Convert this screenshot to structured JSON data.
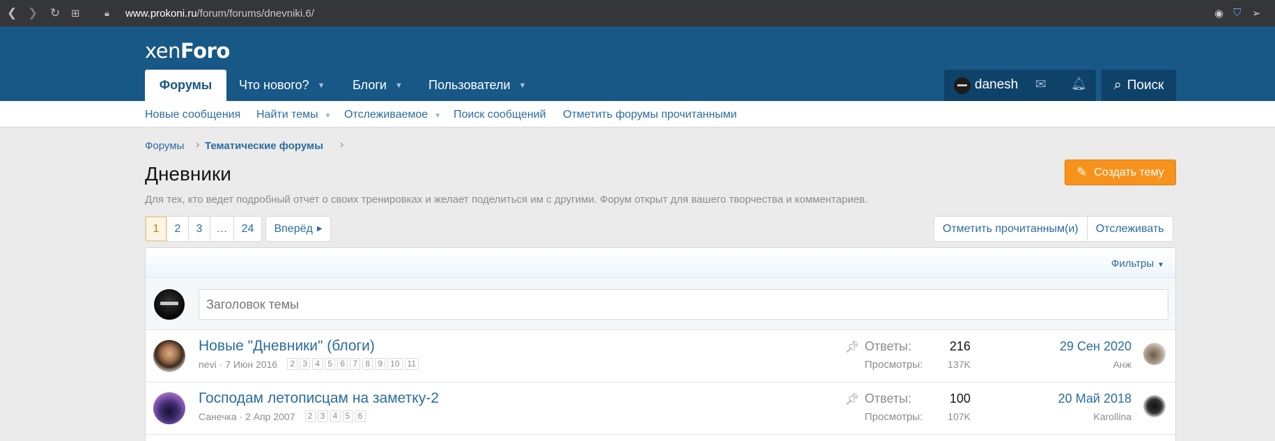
{
  "browser": {
    "url_domain": "www.prokoni.ru",
    "url_path": "/forum/forums/dnevniki.6/",
    "nav_icons": [
      "back-icon",
      "forward-icon",
      "reload-icon",
      "apps-icon",
      "lock-icon"
    ],
    "right_icons": [
      "camera-icon",
      "shield-icon",
      "send-icon"
    ]
  },
  "header": {
    "logo_left": "xen",
    "logo_right": "Foro",
    "tabs": [
      {
        "label": "Форумы",
        "active": true
      },
      {
        "label": "Что нового?",
        "dropdown": true
      },
      {
        "label": "Блоги",
        "dropdown": true
      },
      {
        "label": "Пользователи",
        "dropdown": true
      }
    ],
    "username": "danesh",
    "search_label": "Поиск"
  },
  "subnav": [
    {
      "label": "Новые сообщения"
    },
    {
      "label": "Найти темы",
      "dropdown": true
    },
    {
      "label": "Отслеживаемое",
      "dropdown": true
    },
    {
      "label": "Поиск сообщений"
    },
    {
      "label": "Отметить форумы прочитанными"
    }
  ],
  "breadcrumb": [
    {
      "label": "Форумы",
      "bold": false
    },
    {
      "label": "Тематические форумы",
      "bold": true
    }
  ],
  "forum": {
    "title": "Дневники",
    "description": "Для тех, кто ведет подробный отчет о своих тренировках и желает поделиться им с другими. Форум открыт для вашего творчества и комментариев.",
    "create_button": "Создать тему"
  },
  "pagination": {
    "pages": [
      "1",
      "2",
      "3",
      "…",
      "24"
    ],
    "current": "1",
    "next_label": "Вперёд"
  },
  "actions": {
    "mark_read": "Отметить прочитанным(и)",
    "watch": "Отслеживать"
  },
  "list": {
    "filters_label": "Фильтры",
    "new_thread_placeholder": "Заголовок темы",
    "threads": [
      {
        "title": "Новые \"Дневники\" (блоги)",
        "author": "nevi",
        "date": "7 Июн 2016",
        "pages": [
          "2",
          "3",
          "4",
          "5",
          "6",
          "7",
          "8",
          "9",
          "10",
          "11"
        ],
        "sticky": true,
        "replies_label": "Ответы:",
        "replies": "216",
        "views_label": "Просмотры:",
        "views": "137K",
        "last_date": "29 Сен 2020",
        "last_user": "Анж"
      },
      {
        "title": "Господам летописцам на заметку-2",
        "author": "Санечка",
        "date": "2 Апр 2007",
        "pages": [
          "2",
          "3",
          "4",
          "5",
          "6"
        ],
        "sticky": true,
        "replies_label": "Ответы:",
        "replies": "100",
        "views_label": "Просмотры:",
        "views": "107K",
        "last_date": "20 Май 2018",
        "last_user": "Karollina"
      }
    ]
  },
  "colors": {
    "header_bg": "#185886",
    "link": "#2b6c9f",
    "accent_button": "#f7931d",
    "page_bg": "#ebebeb"
  }
}
